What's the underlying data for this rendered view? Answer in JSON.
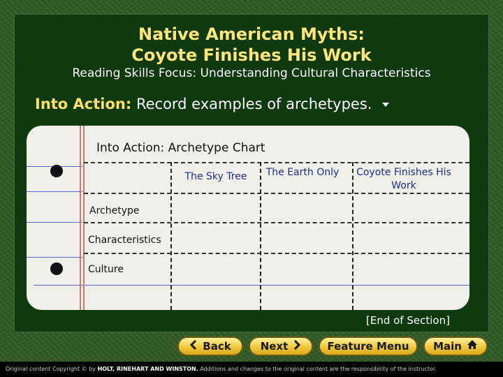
{
  "slide": {
    "title_line1": "Native American Myths:",
    "title_line2": "Coyote Finishes His Work",
    "subtitle": "Reading Skills Focus: Understanding Cultural Characteristics",
    "into_action_lead": "Into Action:",
    "into_action_text": "Record examples of archetypes."
  },
  "chart": {
    "title": "Into Action: Archetype Chart",
    "columns": [
      "The Sky Tree",
      "The Earth Only",
      "Coyote Finishes His Work"
    ],
    "rows": [
      "Archetype",
      "Characteristics",
      "Culture"
    ]
  },
  "end_of_section": "[End of Section]",
  "nav": {
    "back": "Back",
    "next": "Next",
    "feature_menu": "Feature Menu",
    "main": "Main"
  },
  "footer": {
    "prefix": "Original content Copyright © by",
    "brand": "HOLT, RINEHART AND WINSTON.",
    "suffix": "Additions and changes to the original content are the responsibility of the instructor."
  },
  "colors": {
    "title": "#ffe57a",
    "button": "#f0c83a",
    "panel": "#0f3a10"
  }
}
